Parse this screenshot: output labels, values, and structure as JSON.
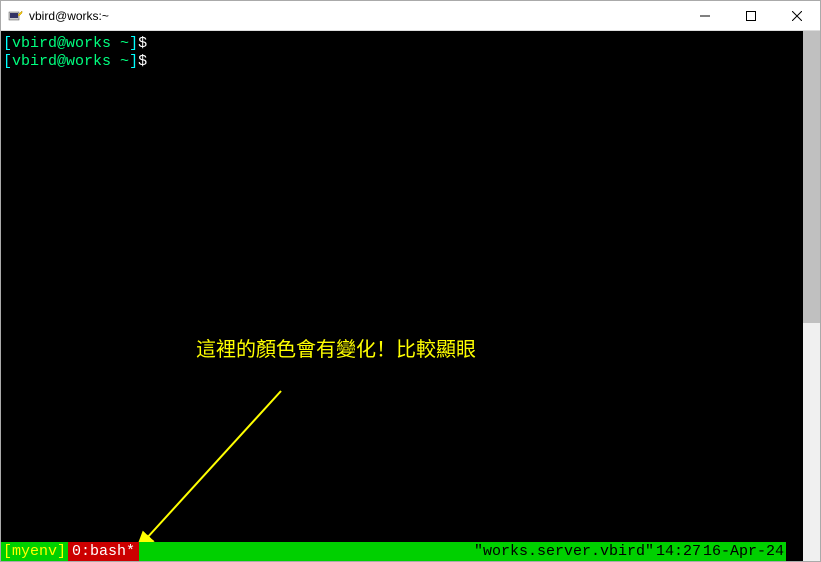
{
  "window": {
    "title": "vbird@works:~"
  },
  "terminal": {
    "lines": [
      {
        "bracket_open": "[",
        "userhost": "vbird@works ",
        "path": "~",
        "bracket_close": "]",
        "dollar": "$"
      },
      {
        "bracket_open": "[",
        "userhost": "vbird@works ",
        "path": "~",
        "bracket_close": "]",
        "dollar": "$"
      }
    ]
  },
  "annotation": {
    "text": "這裡的顏色會有變化！比較顯眼"
  },
  "status": {
    "session": "[myenv]",
    "window": "0:bash*",
    "hostname": "\"works.server.vbird\"",
    "time": "14:27",
    "date": "16-Apr-24"
  }
}
